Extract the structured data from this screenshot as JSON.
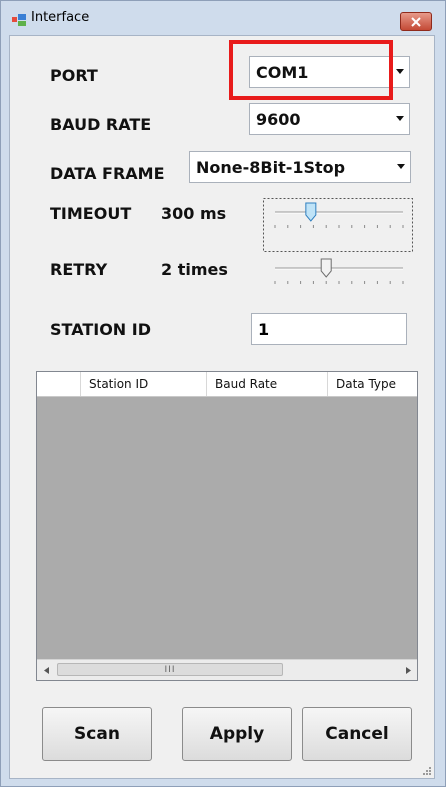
{
  "window": {
    "title": "Interface"
  },
  "port": {
    "label": "PORT",
    "value": "COM1"
  },
  "baud_rate": {
    "label": "BAUD RATE",
    "value": "9600"
  },
  "data_frame": {
    "label": "DATA FRAME",
    "value": "None-8Bit-1Stop"
  },
  "timeout": {
    "label": "TIMEOUT",
    "value_text": "300 ms",
    "slider_fraction": 0.28
  },
  "retry": {
    "label": "RETRY",
    "value_text": "2 times",
    "slider_fraction": 0.4
  },
  "station_id": {
    "label": "STATION ID",
    "value": "1"
  },
  "table": {
    "columns": [
      "",
      "Station ID",
      "Baud Rate",
      "Data Type"
    ],
    "scroll_thumb_text": "III"
  },
  "buttons": {
    "scan": "Scan",
    "apply": "Apply",
    "cancel": "Cancel"
  },
  "colors": {
    "highlight": "#e81b1b",
    "client_bg": "#f0f0f0",
    "grid_bg": "#ababab",
    "close_red": "#c44a36"
  },
  "icons": {
    "app": "interface-app-icon",
    "close": "close-icon",
    "dropdown": "chevron-down-icon",
    "scroll_left": "scroll-left-icon",
    "scroll_right": "scroll-right-icon",
    "grip": "resize-grip-icon"
  }
}
